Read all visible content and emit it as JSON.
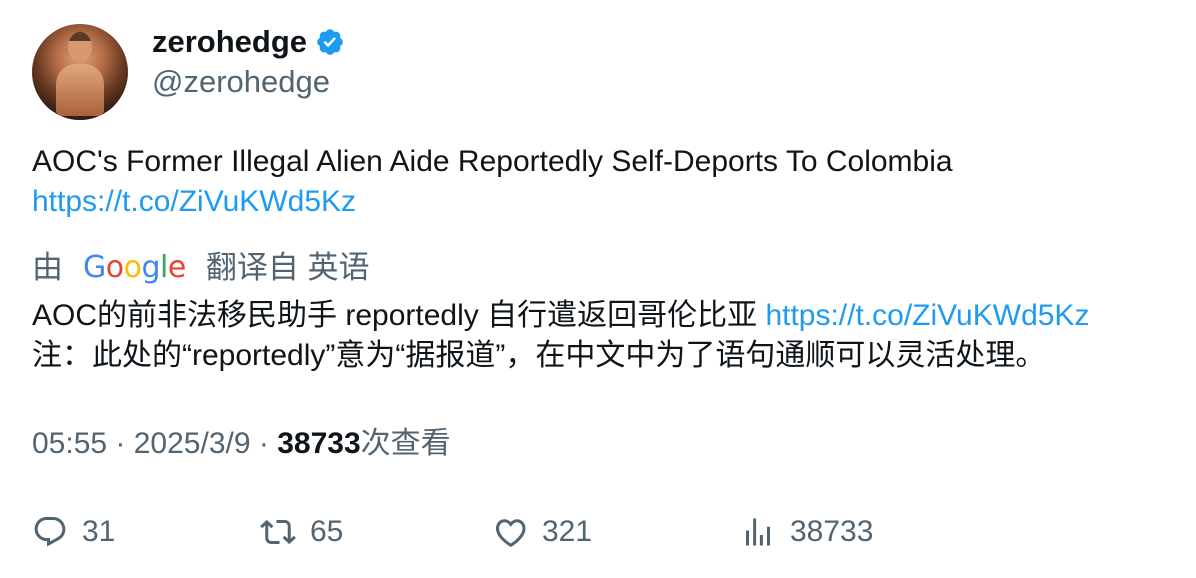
{
  "author": {
    "name": "zerohedge",
    "handle": "@zerohedge",
    "verified_color": "#1d9bf0"
  },
  "tweet": {
    "text": "AOC's Former Illegal Alien Aide Reportedly Self-Deports To Colombia",
    "link": "https://t.co/ZiVuKWd5Kz"
  },
  "translation": {
    "prefix": "由",
    "provider": "Google",
    "suffix": "翻译自 英语",
    "text": "AOC的前非法移民助手 reportedly 自行遣返回哥伦比亚",
    "link": "https://t.co/ZiVuKWd5Kz",
    "note": "注：此处的“reportedly”意为“据报道”，在中文中为了语句通顺可以灵活处理。"
  },
  "meta": {
    "time": "05:55",
    "sep1": " · ",
    "date": "2025/3/9",
    "sep2": " · ",
    "views": "38733",
    "views_label": "次查看"
  },
  "actions": {
    "replies": "31",
    "retweets": "65",
    "likes": "321",
    "views": "38733"
  },
  "colors": {
    "link": "#1d9bf0",
    "secondary_text": "#536471",
    "primary_text": "#0f1419"
  }
}
